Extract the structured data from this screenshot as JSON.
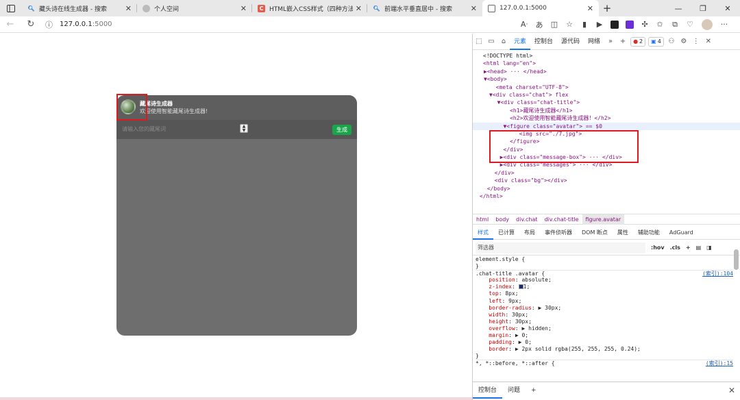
{
  "tabs": [
    {
      "title": "藏头诗在线生成器 - 搜索",
      "favicon": "search-icon"
    },
    {
      "title": "个人空间",
      "favicon": "globe-icon"
    },
    {
      "title": "HTML嵌入CSS样式（四种方法)",
      "favicon": "C"
    },
    {
      "title": "前端水平垂直居中 - 搜索",
      "favicon": "search-icon"
    },
    {
      "title": "127.0.0.1:5000",
      "favicon": "page-icon"
    }
  ],
  "address": {
    "host": "127.0.0.1",
    "port": ":5000"
  },
  "chat": {
    "title": "藏尾诗生成器",
    "subtitle": "欢迎使用智能藏尾诗生成器!",
    "input_placeholder": "请输入您的藏尾词",
    "send_label": "生成"
  },
  "devtools": {
    "tabs": [
      "元素",
      "控制台",
      "源代码",
      "网络"
    ],
    "errors": "2",
    "messages": "4",
    "dom": [
      "<!DOCTYPE html>",
      "<html lang=\"en\">",
      "▶<head> ··· </head>",
      "▼<body>",
      "  <meta charset=\"UTF-8\">",
      "▼<div class=\"chat\"> flex",
      "  ▼<div class=\"chat-title\">",
      "     <h1>藏尾诗生成器</h1>",
      "     <h2>欢迎使用智能藏尾诗生成器！</h2>",
      "   ▼<figure class=\"avatar\"> == $0",
      "       <img src=\"./7.jpg\">",
      "     </figure>",
      "   </div>",
      "  ▶<div class=\"message-box\"> ··· </div>",
      "  ▶<div class=\"messages\"> ··· </div>",
      "  </div>",
      "  <div class=\"bg\"></div>",
      " </body>",
      "</html>"
    ],
    "breadcrumb": [
      "html",
      "body",
      "div.chat",
      "div.chat-title",
      "figure.avatar"
    ],
    "subtabs": [
      "样式",
      "已计算",
      "布局",
      "事件侦听器",
      "DOM 断点",
      "属性",
      "辅助功能",
      "AdGuard"
    ],
    "filter_placeholder": "筛选器",
    "hov": ":hov",
    "cls": ".cls",
    "rules": [
      {
        "t": "sel",
        "text": "element.style {"
      },
      {
        "t": "plain",
        "text": "}"
      },
      {
        "t": "sel",
        "text": ".chat-title .avatar {",
        "src": "(索引):104"
      },
      {
        "t": "decl",
        "prop": "position",
        "val": "absolute;"
      },
      {
        "t": "decl",
        "prop": "z-index",
        "val": "1;"
      },
      {
        "t": "decl",
        "prop": "top",
        "val": "8px;"
      },
      {
        "t": "decl",
        "prop": "left",
        "val": "9px;"
      },
      {
        "t": "decl",
        "prop": "border-radius",
        "val": "▶ 30px;"
      },
      {
        "t": "decl",
        "prop": "width",
        "val": "30px;"
      },
      {
        "t": "decl",
        "prop": "height",
        "val": "30px;"
      },
      {
        "t": "decl",
        "prop": "overflow",
        "val": "▶ hidden;"
      },
      {
        "t": "decl",
        "prop": "margin",
        "val": "▶ 0;"
      },
      {
        "t": "decl",
        "prop": "padding",
        "val": "▶ 0;"
      },
      {
        "t": "decl",
        "prop": "border",
        "val": "▶ 2px solid rgba(255, 255, 255, 0.24);"
      },
      {
        "t": "plain",
        "text": "}"
      },
      {
        "t": "sel",
        "text": "*, *::before, *::after {",
        "src": "(索引):15"
      }
    ],
    "drawer": [
      "控制台",
      "问题"
    ]
  }
}
